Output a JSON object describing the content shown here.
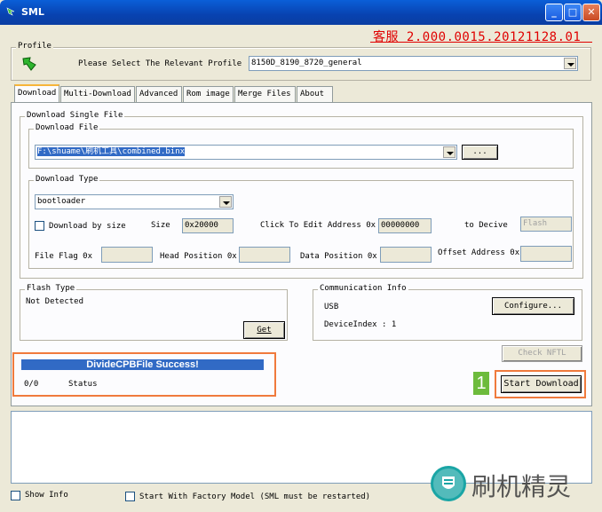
{
  "window": {
    "title": "SML",
    "min": "_",
    "max": "□",
    "close": "✕"
  },
  "version": "客服 2.000.0015.20121128.01",
  "profile": {
    "group_label": "Profile",
    "prompt": "Please Select The Relevant Profile",
    "selected": "8150D_8190_8720_general"
  },
  "tabs": [
    {
      "label": "Download"
    },
    {
      "label": "Multi-Download"
    },
    {
      "label": "Advanced"
    },
    {
      "label": "Rom image"
    },
    {
      "label": "Merge Files"
    },
    {
      "label": "About"
    }
  ],
  "single": {
    "group_label": "Download Single File",
    "file_group": "Download File",
    "file_path": "F:\\shuame\\刷机工具\\combined.binx",
    "browse": "...",
    "type_group": "Download Type",
    "type_selected": "bootloader",
    "by_size_label": "Download by size",
    "size_label": "Size",
    "size_value": "0x20000",
    "edit_addr_label": "Click To Edit Address 0x",
    "edit_addr_value": "00000000",
    "to_device_label": "to Decive",
    "to_device_value": "Flash",
    "file_flag_label": "File Flag  0x",
    "head_pos_label": "Head Position 0x",
    "data_pos_label": "Data Position 0x",
    "offset_label": "Offset Address 0x"
  },
  "flash": {
    "group_label": "Flash Type",
    "value": "Not Detected",
    "get": "Get"
  },
  "comm": {
    "group_label": "Communication Info",
    "usb": "USB",
    "configure": "Configure...",
    "device_index": "DeviceIndex : 1"
  },
  "check_nftl": "Check NFTL",
  "progress": {
    "text": "DivideCPBFile Success!",
    "count": "0/0",
    "status": "Status",
    "fill": 1.0
  },
  "marker": "1",
  "start_download": "Start Download",
  "show_info": "Show Info",
  "factory": "Start With Factory Model (SML must be restarted)",
  "watermark": "刷机精灵",
  "colors": {
    "highlight": "#f07a3c",
    "progress": "#316ac5",
    "marker": "#6dbb3c"
  }
}
